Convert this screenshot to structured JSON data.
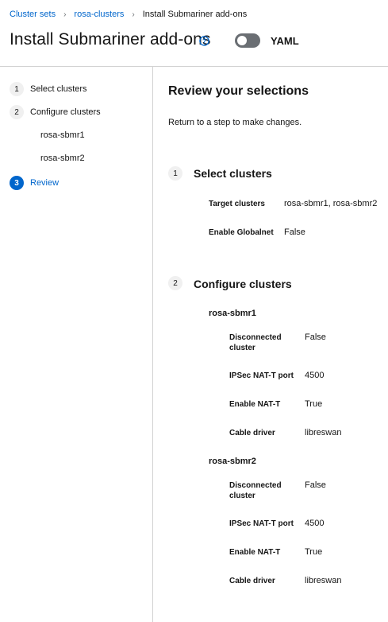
{
  "breadcrumb": {
    "cluster_sets": "Cluster sets",
    "rosa_clusters": "rosa-clusters",
    "current": "Install Submariner add-ons"
  },
  "header": {
    "title": "Install Submariner add-ons",
    "yaml_label": "YAML"
  },
  "nav": {
    "steps": [
      {
        "num": "1",
        "label": "Select clusters"
      },
      {
        "num": "2",
        "label": "Configure clusters"
      },
      {
        "num": "3",
        "label": "Review"
      }
    ],
    "sub_items": [
      "rosa-sbmr1",
      "rosa-sbmr2"
    ]
  },
  "review": {
    "title": "Review your selections",
    "subtitle": "Return to a step to make changes.",
    "section1": {
      "num": "1",
      "title": "Select clusters",
      "target_label": "Target clusters",
      "target_value": "rosa-sbmr1, rosa-sbmr2",
      "globalnet_label": "Enable Globalnet",
      "globalnet_value": "False"
    },
    "section2": {
      "num": "2",
      "title": "Configure clusters",
      "clusters": [
        {
          "name": "rosa-sbmr1",
          "disconnected_label_1": "Disconnected",
          "disconnected_label_2": "cluster",
          "disconnected_value": "False",
          "ipsec_label": "IPSec NAT-T port",
          "ipsec_value": "4500",
          "natt_label": "Enable NAT-T",
          "natt_value": "True",
          "cable_label": "Cable driver",
          "cable_value": "libreswan"
        },
        {
          "name": "rosa-sbmr2",
          "disconnected_label_1": "Disconnected",
          "disconnected_label_2": "cluster",
          "disconnected_value": "False",
          "ipsec_label": "IPSec NAT-T port",
          "ipsec_value": "4500",
          "natt_label": "Enable NAT-T",
          "natt_value": "True",
          "cable_label": "Cable driver",
          "cable_value": "libreswan"
        }
      ]
    }
  }
}
